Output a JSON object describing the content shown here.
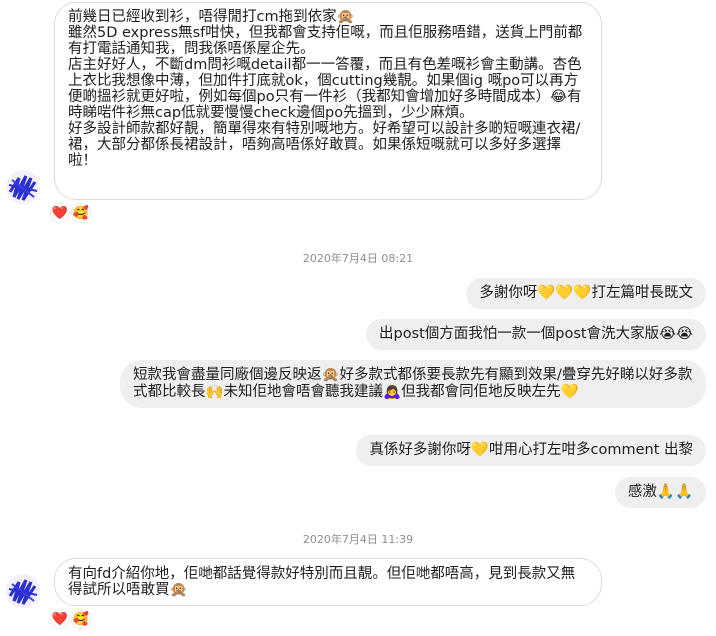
{
  "messages": {
    "m1": {
      "text": "前幾日已經收到衫，唔得閒打cm拖到依家🙊\n雖然5D express無sf咁快，但我都會支持佢嘅，而且佢服務唔錯，送貨上門前都有打電話通知我，問我係唔係屋企先。\n店主好好人，不斷dm問衫嘅detail都一一答覆，而且有色差嘅衫會主動講。杏色上衣比我想像中薄，但加件打底就ok，個cutting幾靚。如果個ig 嘅po可以再方便啲搵衫就更好啦，例如每個po只有一件衫（我都知會增加好多時間成本）😂有時睇啱件衫無cap低就要慢慢check邊個po先搵到，少少麻煩。\n好多設計師款都好靚，簡單得來有特別嘅地方。好希望可以設計多啲短嘅連衣裙/裙，大部分都係長裙設計，唔夠高唔係好敢買。如果係短嘅就可以多好多選擇啦！"
    },
    "ts1": "2020年7月4日 08:21",
    "m2": {
      "text": "多謝你呀💛💛💛打左篇咁長既文"
    },
    "m3": {
      "text": "出post個方面我怕一款一個post會洗大家版😭😭"
    },
    "m4": {
      "text": "短款我會盡量同廠個邊反映返🙊好多款式都係要長款先有顯到效果/疊穿先好睇以好多款式都比較長🙌未知佢地會唔會聽我建議🙇‍♀️但我都會同佢地反映左先💛"
    },
    "m5": {
      "text": "真係好多謝你呀💛咁用心打左咁多comment 出黎"
    },
    "m6": {
      "text": "感激🙏🙏"
    },
    "ts2": "2020年7月4日 11:39",
    "m7": {
      "text": "有向fd介紹你地，佢哋都話覺得款好特別而且靚。但佢哋都唔高，見到長款又無得試所以唔敢買🙊"
    },
    "reactions": {
      "heart": "❤️",
      "second": "🥰"
    }
  }
}
